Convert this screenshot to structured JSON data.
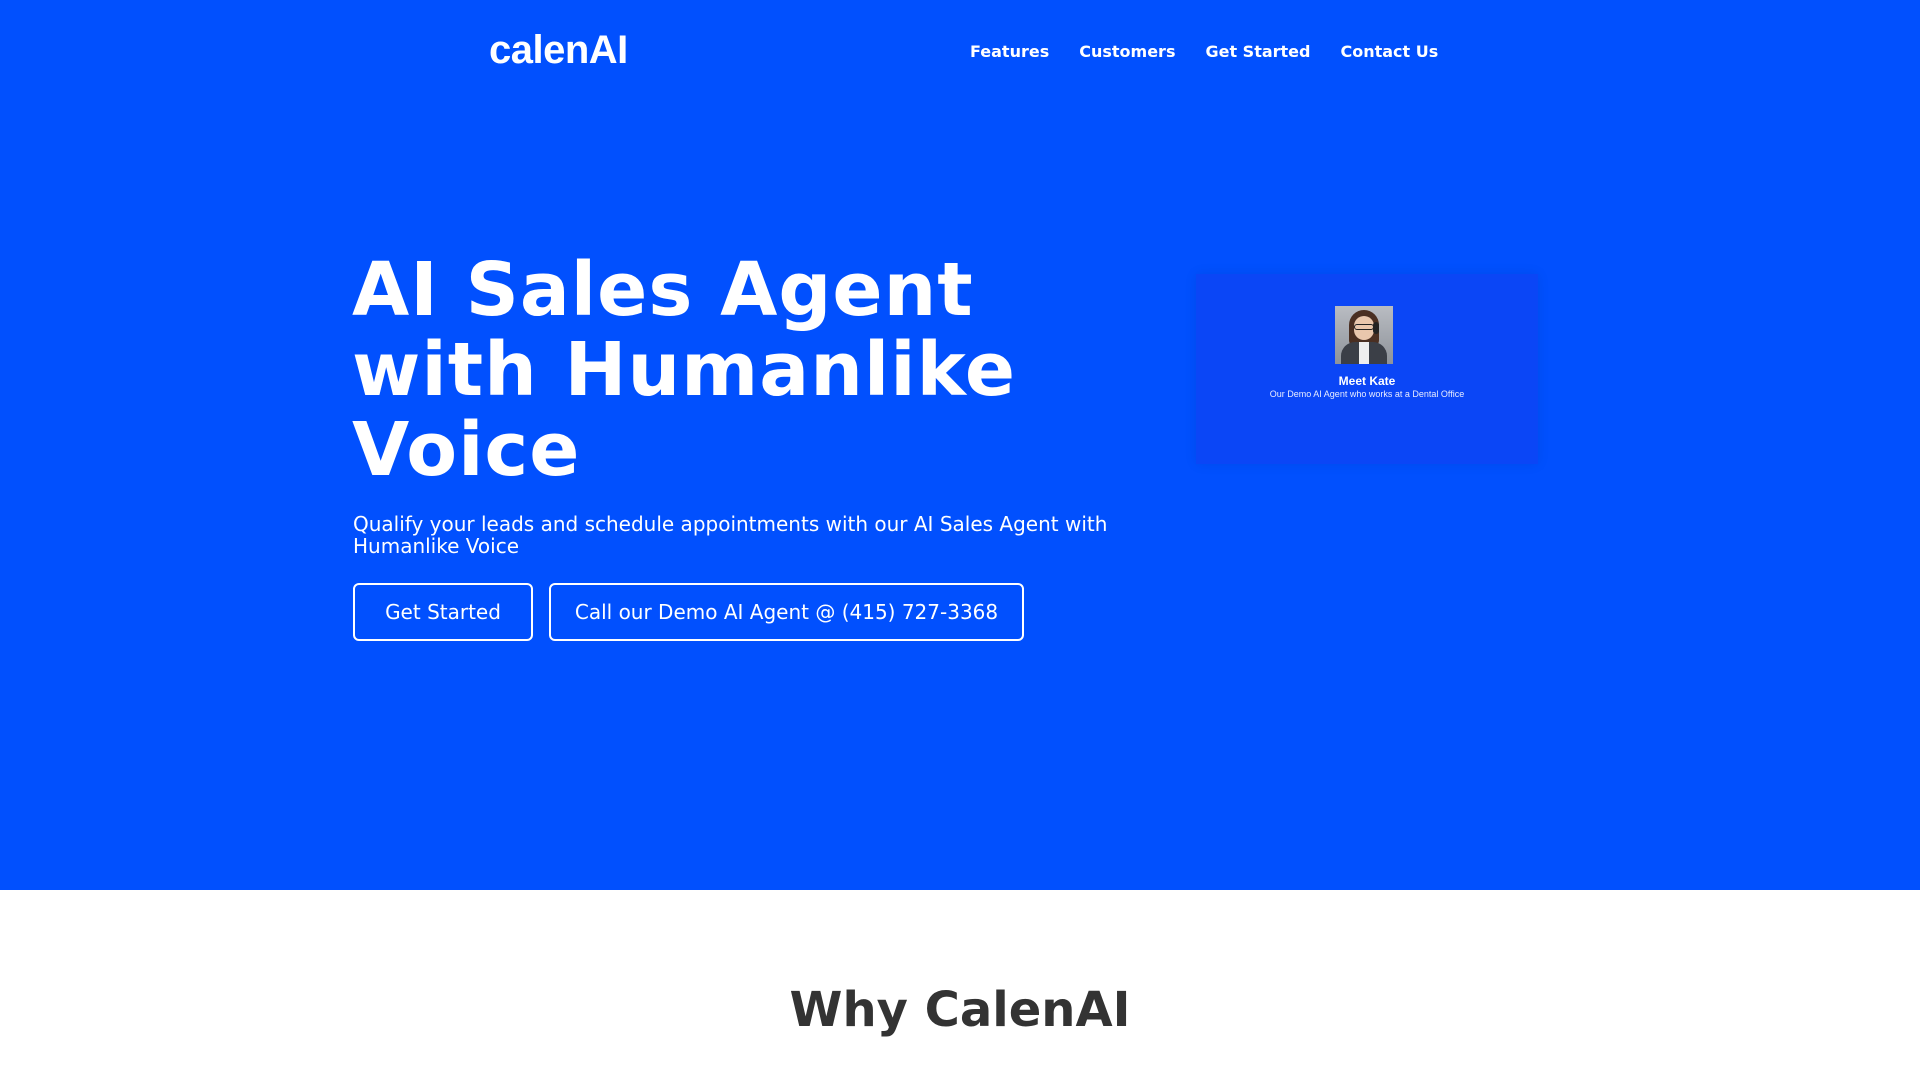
{
  "brand": {
    "logo_text": "calenAI"
  },
  "nav": {
    "items": [
      {
        "label": "Features"
      },
      {
        "label": "Customers"
      },
      {
        "label": "Get Started"
      },
      {
        "label": "Contact Us"
      }
    ]
  },
  "hero": {
    "headline": "AI Sales Agent with Humanlike Voice",
    "subheadline": "Qualify your leads and schedule appointments with our AI Sales Agent with Humanlike Voice",
    "primary_button": "Get Started",
    "secondary_button": "Call our Demo AI Agent @ (415) 727-3368",
    "background_color": "#0150fe"
  },
  "video_card": {
    "title": "Meet Kate",
    "subtitle": "Our Demo AI Agent  who works at a Dental Office",
    "avatar_icon": "agent-avatar-image"
  },
  "section": {
    "why_title": "Why CalenAI"
  }
}
